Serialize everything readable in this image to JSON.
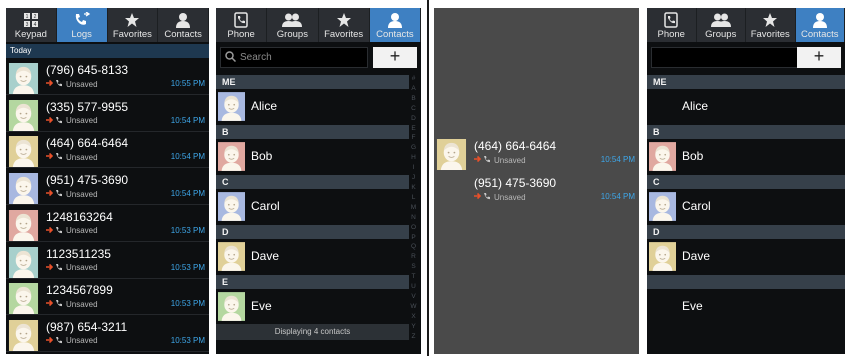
{
  "panel1": {
    "tabs": [
      {
        "label": "Keypad",
        "icon": "keypad-icon",
        "active": false
      },
      {
        "label": "Logs",
        "icon": "logs-icon",
        "active": true
      },
      {
        "label": "Favorites",
        "icon": "star-icon",
        "active": false
      },
      {
        "label": "Contacts",
        "icon": "person-icon",
        "active": false
      }
    ],
    "section": "Today",
    "logs": [
      {
        "number": "(796) 645-8133",
        "status": "Unsaved",
        "time": "10:55 PM",
        "avatar": "#a8d0cc"
      },
      {
        "number": "(335) 577-9955",
        "status": "Unsaved",
        "time": "10:54 PM",
        "avatar": "#b4d7a0"
      },
      {
        "number": "(464) 664-6464",
        "status": "Unsaved",
        "time": "10:54 PM",
        "avatar": "#e0d098"
      },
      {
        "number": "(951) 475-3690",
        "status": "Unsaved",
        "time": "10:54 PM",
        "avatar": "#a8b8e0"
      },
      {
        "number": "1248163264",
        "status": "Unsaved",
        "time": "10:53 PM",
        "avatar": "#e0a8a0"
      },
      {
        "number": "1123511235",
        "status": "Unsaved",
        "time": "10:53 PM",
        "avatar": "#a8d0cc"
      },
      {
        "number": "1234567899",
        "status": "Unsaved",
        "time": "10:53 PM",
        "avatar": "#b4d7a0"
      },
      {
        "number": "(987) 654-3211",
        "status": "Unsaved",
        "time": "10:53 PM",
        "avatar": "#e0d098"
      }
    ]
  },
  "panel2": {
    "tabs": [
      {
        "label": "Phone",
        "icon": "phone-icon",
        "active": false
      },
      {
        "label": "Groups",
        "icon": "groups-icon",
        "active": false
      },
      {
        "label": "Favorites",
        "icon": "star-icon",
        "active": false
      },
      {
        "label": "Contacts",
        "icon": "person-icon",
        "active": true
      }
    ],
    "search_placeholder": "Search",
    "add_label": "+",
    "groups": [
      {
        "header": "ME",
        "name": "Alice",
        "avatar": "#a8b8e0"
      },
      {
        "header": "B",
        "name": "Bob",
        "avatar": "#e0a8a0"
      },
      {
        "header": "C",
        "name": "Carol",
        "avatar": "#a8b8e0"
      },
      {
        "header": "D",
        "name": "Dave",
        "avatar": "#e0d098"
      },
      {
        "header": "E",
        "name": "Eve",
        "avatar": "#b4d7a0"
      }
    ],
    "index_letters": [
      "#",
      "A",
      "B",
      "C",
      "D",
      "E",
      "F",
      "G",
      "H",
      "I",
      "J",
      "K",
      "L",
      "M",
      "N",
      "O",
      "P",
      "Q",
      "R",
      "S",
      "T",
      "U",
      "V",
      "W",
      "X",
      "Y",
      "Z"
    ],
    "footer": "Displaying 4 contacts"
  },
  "panel3": {
    "items": [
      {
        "number": "(464) 664-6464",
        "status": "Unsaved",
        "time": "10:54 PM",
        "avatar": "#e0d098"
      },
      {
        "number": "(951) 475-3690",
        "status": "Unsaved",
        "time": "10:54 PM"
      }
    ]
  },
  "panel4": {
    "tabs": [
      {
        "label": "Phone",
        "icon": "phone-icon",
        "active": false
      },
      {
        "label": "Groups",
        "icon": "groups-icon",
        "active": false
      },
      {
        "label": "Favorites",
        "icon": "star-icon",
        "active": false
      },
      {
        "label": "Contacts",
        "icon": "person-icon",
        "active": true
      }
    ],
    "add_label": "+",
    "groups": [
      {
        "header": "ME",
        "name": "Alice"
      },
      {
        "header": "B",
        "name": "Bob",
        "avatar": "#e0a8a0"
      },
      {
        "header": "C",
        "name": "Carol",
        "avatar": "#a8b8e0"
      },
      {
        "header": "D",
        "name": "Dave",
        "avatar": "#e0d098"
      },
      {
        "header": "",
        "name": "Eve"
      }
    ]
  },
  "colors": {
    "accent": "#3e80c2",
    "time": "#3ea6e8",
    "missed_arrow": "#e8502a"
  }
}
